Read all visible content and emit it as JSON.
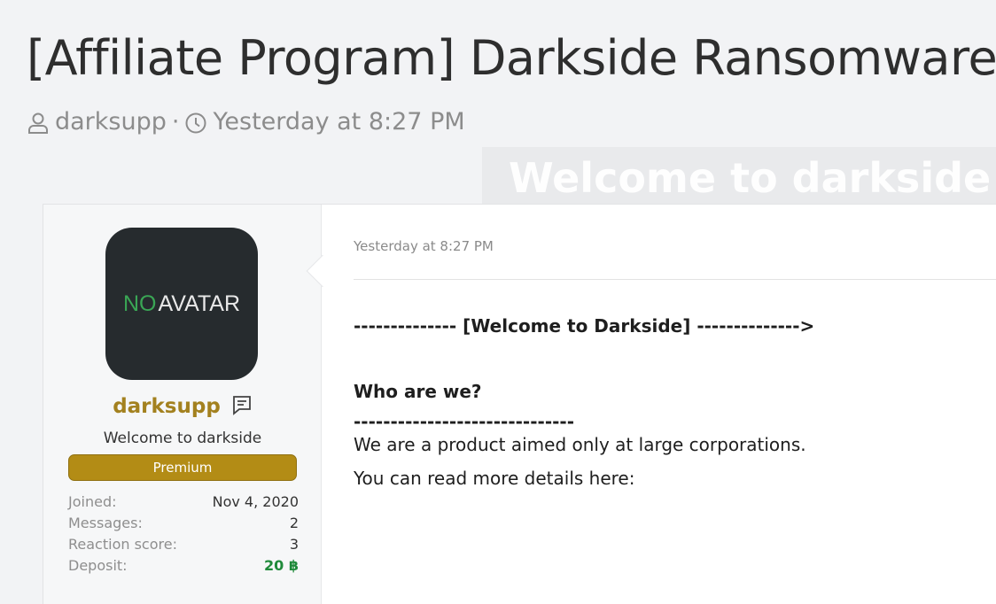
{
  "thread": {
    "title": "[Affiliate Program] Darkside Ransomware",
    "author": "darksupp",
    "separator": "·",
    "time": "Yesterday at 8:27 PM"
  },
  "banner": {
    "text": "Welcome to darkside"
  },
  "user": {
    "avatar_text_a": "NO",
    "avatar_text_b": "AVATAR",
    "username": "darksupp",
    "title": "Welcome to darkside",
    "badge": "Premium",
    "stats": [
      {
        "label": "Joined:",
        "value": "Nov 4, 2020"
      },
      {
        "label": "Messages:",
        "value": "2"
      },
      {
        "label": "Reaction score:",
        "value": "3"
      },
      {
        "label": "Deposit:",
        "value": "20 ฿"
      }
    ]
  },
  "post": {
    "date": "Yesterday at 8:27 PM",
    "welcome_line": "-------------- [Welcome to Darkside] -------------->",
    "heading": "Who are we?",
    "heading_rule": "------------------------------",
    "paragraph1": "We are a product aimed only at large corporations.",
    "paragraph2": "You can read more details here:"
  },
  "colors": {
    "username": "#a3811f",
    "badge": "#b38c15",
    "deposit": "#1f8a3a",
    "avatar_bg": "#262b2e",
    "avatar_no": "#3aa655"
  },
  "icons": [
    "user-icon",
    "clock-icon",
    "message-icon"
  ]
}
